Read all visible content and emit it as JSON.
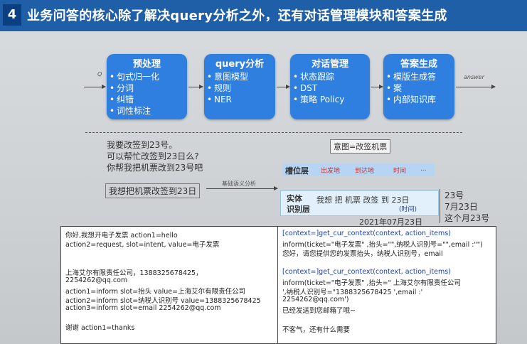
{
  "slide": {
    "number": "4",
    "title": "业务问答的核心除了解决query分析之外，还有对话管理模块和答案生成"
  },
  "pipeline": {
    "input_label": "Q",
    "output_label": "answer",
    "modules": [
      {
        "title": "预处理",
        "items": [
          "句式归一化",
          "分词",
          "纠错",
          "词性标注"
        ]
      },
      {
        "title": "query分析",
        "items": [
          "意图模型",
          "规则",
          "NER"
        ]
      },
      {
        "title": "对话管理",
        "items": [
          "状态跟踪",
          "DST",
          "策略 Policy"
        ]
      },
      {
        "title": "答案生成",
        "items": [
          "模版生成答",
          "案",
          "内部知识库"
        ]
      }
    ]
  },
  "example": {
    "utterances": [
      "我要改签到23号。",
      "可以帮忙改签到23日么?",
      "你帮我把机票改到23号吧"
    ],
    "normalized": "我想把机票改签到23日",
    "analysis_label": "基础语义分析",
    "intent": "意图=改签机票",
    "slot_layer_label": "槽位层",
    "slots": [
      "出发地",
      "到达地",
      "时间",
      "..."
    ],
    "entity_label": "实体",
    "recognition_label": "识别层",
    "tokens": "我想 把 机票 改签 到 23日",
    "time_tag": "(时间)",
    "date_result": "2021年07月23日",
    "date_candidates": [
      "23号",
      "7月23日",
      "这个月23号"
    ]
  },
  "left_panel": {
    "lines": [
      "你好,我想开电子发票 action1=hello",
      "action2=request, slot=intent, value=电子发票",
      "上海艾尔有限责任公司，1388325678425，",
      "2254262@qq.com",
      "action1=inform slot=抬头 value=上海艾尔有限责任公司",
      "action2=inform slot=纳税人识别号 value=1388325678425",
      "action3=inform slot=email 2254262@qq.com",
      "谢谢  action1=thanks"
    ]
  },
  "right_panel": {
    "lines": [
      "[context=]get_cur_context(context, action_items)",
      "inform(ticket=\"电子发票\" ,抬头=\"\",纳税人识别号=\"\",email :\"\")",
      "您好，请您提供您的发票抬头，纳税人识别号，email",
      "[context=]get_cur_context(context, action_items)",
      "inform(ticket=\"电子发票\" ,抬头=\" 上海艾尔有限责任公司",
      "',纳税人识别号=\"1388325678425 ',email :'",
      "2254262@qq.com')",
      "已经发送到您邮箱了哦~",
      "不客气，还有什么需要"
    ]
  }
}
